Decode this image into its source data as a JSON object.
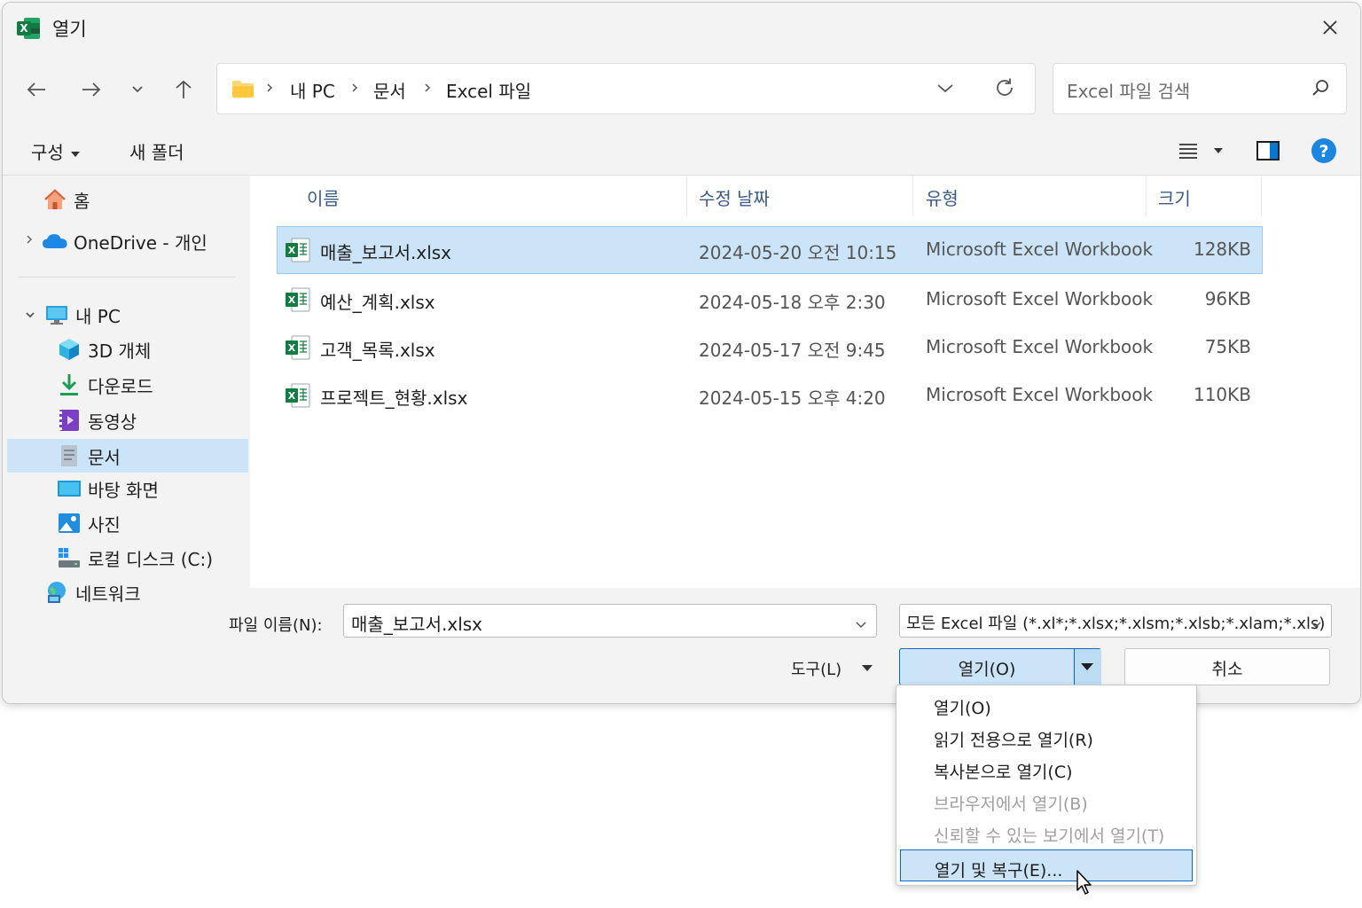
{
  "window": {
    "title": "열기"
  },
  "nav": {
    "path": [
      "내 PC",
      "문서",
      "Excel 파일"
    ],
    "search_placeholder": "Excel 파일 검색"
  },
  "toolbar": {
    "organize": "구성",
    "new_folder": "새 폴더"
  },
  "sidebar": {
    "home": "홈",
    "onedrive": "OneDrive - 개인",
    "this_pc": "내 PC",
    "items": [
      "3D 개체",
      "다운로드",
      "동영상",
      "문서",
      "바탕 화면",
      "사진",
      "로컬 디스크 (C:)"
    ],
    "network": "네트워크"
  },
  "columns": {
    "name": "이름",
    "date": "수정 날짜",
    "type": "유형",
    "size": "크기"
  },
  "files": [
    {
      "name": "매출_보고서.xlsx",
      "date": "2024-05-20 오전 10:15",
      "type": "Microsoft Excel Workbook",
      "size": "128KB"
    },
    {
      "name": "예산_계획.xlsx",
      "date": "2024-05-18 오후 2:30",
      "type": "Microsoft Excel Workbook",
      "size": "96KB"
    },
    {
      "name": "고객_목록.xlsx",
      "date": "2024-05-17 오전 9:45",
      "type": "Microsoft Excel Workbook",
      "size": "75KB"
    },
    {
      "name": "프로젝트_현황.xlsx",
      "date": "2024-05-15 오후 4:20",
      "type": "Microsoft Excel Workbook",
      "size": "110KB"
    }
  ],
  "footer": {
    "filename_label": "파일 이름(N):",
    "filename_value": "매출_보고서.xlsx",
    "filetype_value": "모든 Excel 파일 (*.xl*;*.xlsx;*.xlsm;*.xlsb;*.xlam;*.xls)",
    "tools": "도구(L)",
    "open": "열기(O)",
    "cancel": "취소"
  },
  "open_menu": [
    {
      "label": "열기(O)",
      "enabled": true
    },
    {
      "label": "읽기 전용으로 열기(R)",
      "enabled": true
    },
    {
      "label": "복사본으로 열기(C)",
      "enabled": true
    },
    {
      "label": "브라우저에서 열기(B)",
      "enabled": false
    },
    {
      "label": "신뢰할 수 있는 보기에서 열기(T)",
      "enabled": false
    },
    {
      "label": "열기 및 복구(E)...",
      "enabled": true,
      "highlighted": true
    }
  ],
  "colors": {
    "accent": "#0067c0",
    "selection": "#cce4f7",
    "excel_green": "#107c41"
  }
}
